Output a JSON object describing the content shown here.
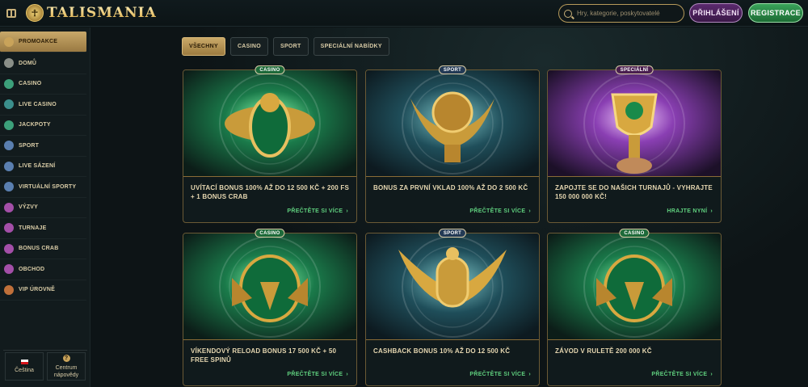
{
  "header": {
    "logo_text": "TALISMANIA",
    "search_placeholder": "Hry, kategorie, poskytovatelé",
    "login_label": "PŘIHLÁŠENÍ",
    "register_label": "REGISTRACE"
  },
  "sidebar": {
    "items": [
      {
        "label": "PROMOAKCE",
        "icon": "gift-icon",
        "color": "#c9a35a"
      },
      {
        "label": "DOMŮ",
        "icon": "home-icon",
        "color": "#8a8f88"
      },
      {
        "label": "CASINO",
        "icon": "casino-icon",
        "color": "#3ca07a"
      },
      {
        "label": "LIVE CASINO",
        "icon": "live-casino-icon",
        "color": "#3b8f8c"
      },
      {
        "label": "JACKPOTY",
        "icon": "jackpot-icon",
        "color": "#3ca07a"
      },
      {
        "label": "SPORT",
        "icon": "sport-icon",
        "color": "#5a7fb0"
      },
      {
        "label": "LIVE SÁZENÍ",
        "icon": "live-betting-icon",
        "color": "#5a7fb0"
      },
      {
        "label": "VIRTUÁLNÍ SPORTY",
        "icon": "virtual-sports-icon",
        "color": "#5a7fb0"
      },
      {
        "label": "VÝZVY",
        "icon": "challenges-icon",
        "color": "#a44fa8"
      },
      {
        "label": "TURNAJE",
        "icon": "tournaments-icon",
        "color": "#a44fa8"
      },
      {
        "label": "BONUS CRAB",
        "icon": "crab-icon",
        "color": "#a44fa8"
      },
      {
        "label": "OBCHOD",
        "icon": "shop-icon",
        "color": "#a44fa8"
      },
      {
        "label": "VIP ÚROVNĚ",
        "icon": "vip-icon",
        "color": "#c0703a"
      }
    ],
    "footer": {
      "language_label": "Čeština",
      "help_label_1": "Centrum",
      "help_label_2": "nápovědy"
    }
  },
  "filters": [
    {
      "label": "VŠECHNY",
      "active": true
    },
    {
      "label": "CASINO",
      "active": false
    },
    {
      "label": "SPORT",
      "active": false
    },
    {
      "label": "SPECIÁLNÍ NABÍDKY",
      "active": false
    }
  ],
  "promos": [
    {
      "tag": "CASINO",
      "tag_type": "casino",
      "title": "UVÍTACÍ BONUS 100% AŽ DO 12 500 KČ + 200 FS + 1 BONUS CRAB",
      "link": "PŘEČTĚTE SI VÍCE",
      "art": "scarab-icon"
    },
    {
      "tag": "SPORT",
      "tag_type": "sport",
      "title": "BONUS ZA PRVNÍ VKLAD 100% AŽ DO 2 500 KČ",
      "link": "PŘEČTĚTE SI VÍCE",
      "art": "winged-ball-icon"
    },
    {
      "tag": "SPECIÁLNÍ",
      "tag_type": "special",
      "title": "ZAPOJTE SE DO NAŠICH TURNAJŮ - VYHRAJTE 150 000 000 KČ!",
      "link": "HRAJTE NYNÍ",
      "art": "trophy-icon"
    },
    {
      "tag": "CASINO",
      "tag_type": "casino",
      "title": "VÍKENDOVÝ RELOAD BONUS 17 500 KČ + 50 FREE SPINŮ",
      "link": "PŘEČTĚTE SI VÍCE",
      "art": "anubis-icon"
    },
    {
      "tag": "SPORT",
      "tag_type": "sport",
      "title": "CASHBACK BONUS 10% AŽ DO 12 500 KČ",
      "link": "PŘEČTĚTE SI VÍCE",
      "art": "pharaoh-icon"
    },
    {
      "tag": "CASINO",
      "tag_type": "casino",
      "title": "ZÁVOD V RULETĚ 200 000 KČ",
      "link": "PŘEČTĚTE SI VÍCE",
      "art": "anubis-icon"
    }
  ]
}
